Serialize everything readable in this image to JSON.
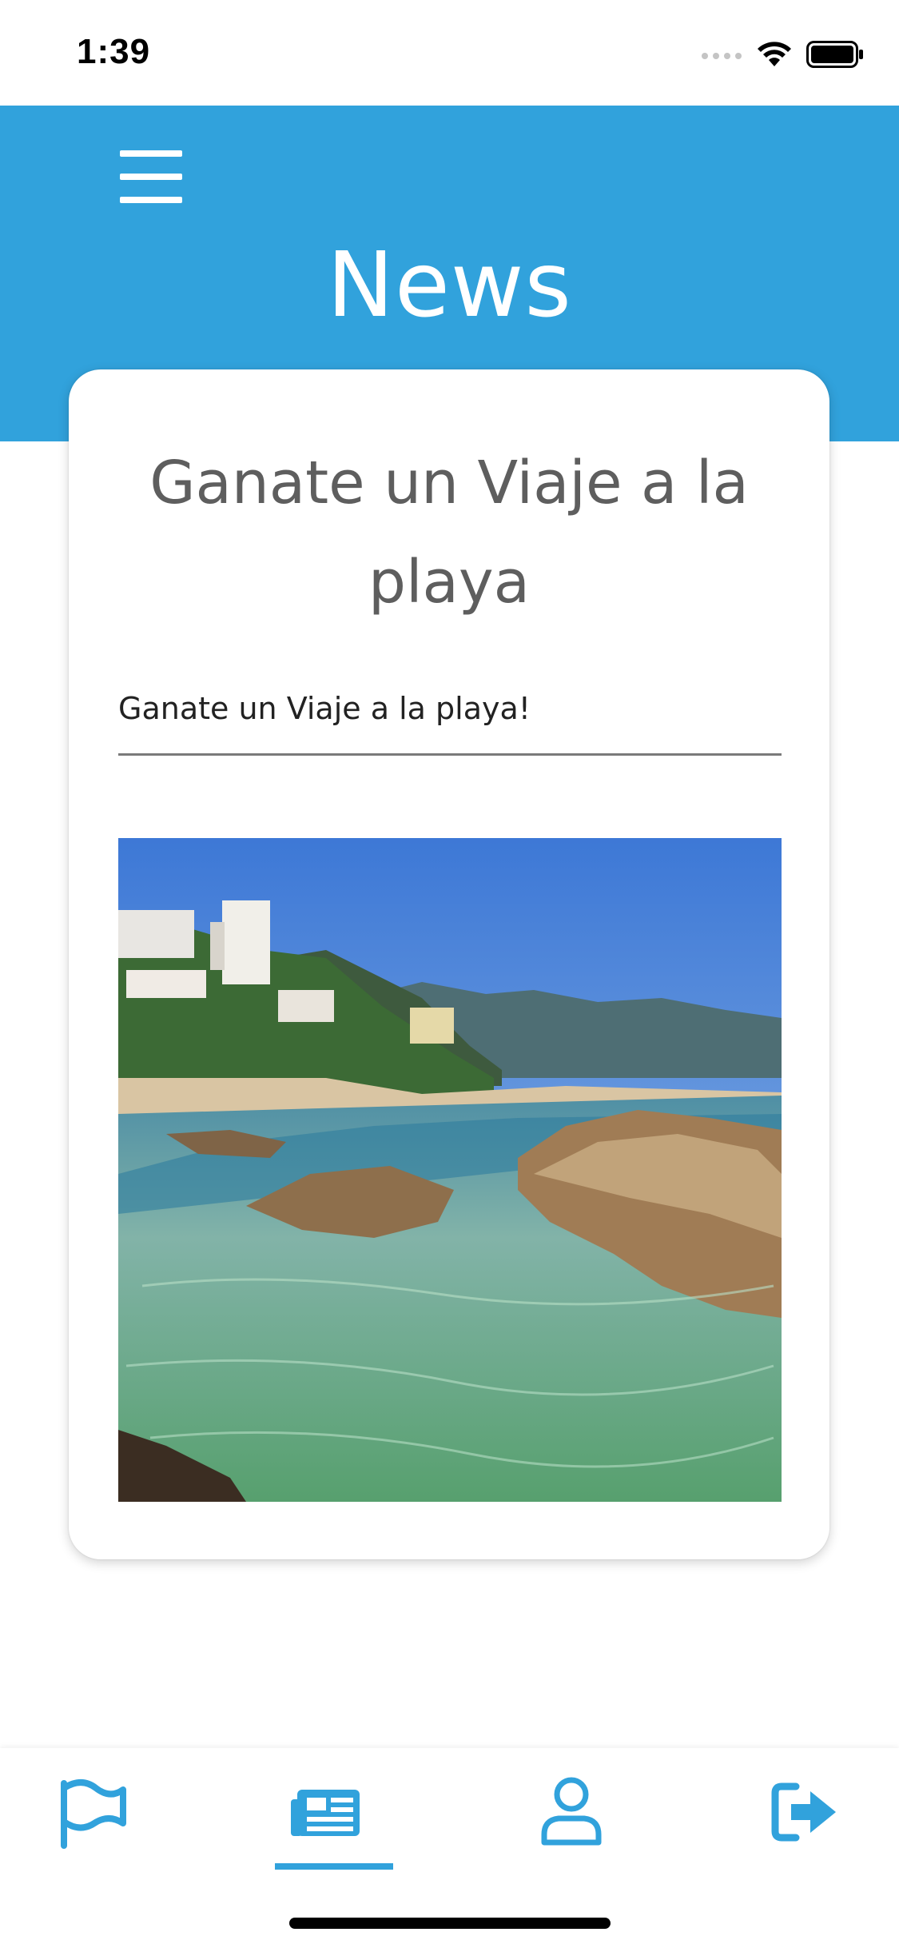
{
  "status_bar": {
    "time": "1:39"
  },
  "header": {
    "title": "News",
    "menu_icon": "hamburger-menu-icon",
    "background_color": "#31a2dc"
  },
  "card": {
    "title": "Ganate un Viaje a la playa",
    "subtitle": "Ganate un Viaje a la playa!",
    "image": "beach-photo"
  },
  "tab_bar": {
    "active_index": 1,
    "accent_color": "#31a2dc",
    "tabs": [
      {
        "icon": "flag-icon"
      },
      {
        "icon": "newspaper-icon"
      },
      {
        "icon": "user-icon"
      },
      {
        "icon": "sign-out-icon"
      }
    ]
  }
}
